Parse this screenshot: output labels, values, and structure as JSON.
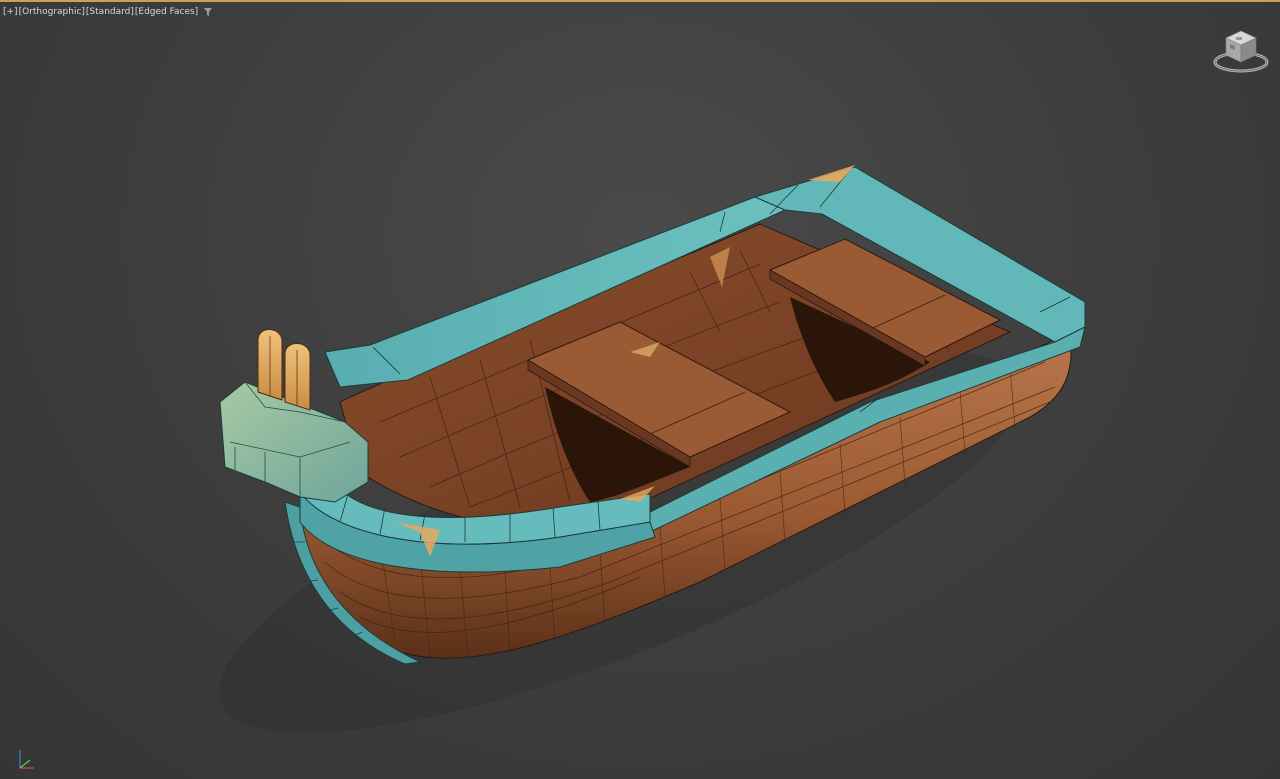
{
  "viewport": {
    "menus": [
      {
        "label": "[+]"
      },
      {
        "label": "[Orthographic]"
      },
      {
        "label": "[Standard]"
      },
      {
        "label": "[Edged Faces]"
      }
    ],
    "filter_icon": "funnel-icon",
    "viewcube_icon": "viewcube-icon",
    "axis_icon": "axis-tripod-icon"
  },
  "colors": {
    "background": "#3d3d3d",
    "active_border": "#c9a34a",
    "rim_teal": "#5fb3b3",
    "hull_wood": "#a4643a",
    "interior_wood": "#7a4428",
    "seat_wood": "#8e4e2c",
    "motor_body": "#8fb89a",
    "motor_top": "#e0a860"
  }
}
